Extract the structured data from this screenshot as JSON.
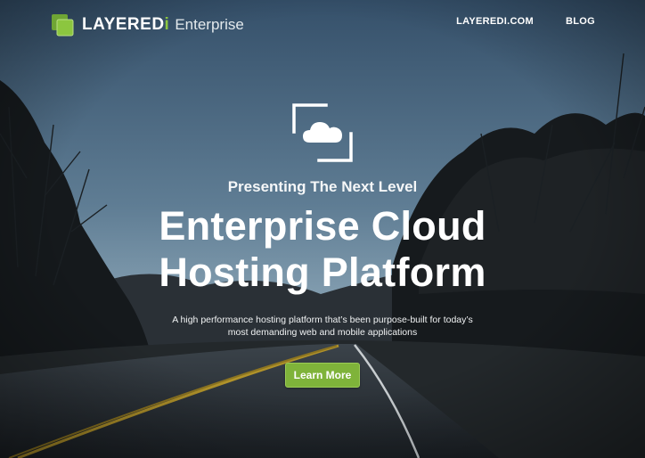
{
  "header": {
    "brand_name": "LAYERED",
    "brand_i": "i",
    "brand_sub": "Enterprise",
    "nav": [
      {
        "label": "LAYEREDI.COM"
      },
      {
        "label": "BLOG"
      }
    ]
  },
  "hero": {
    "icon": "cloud-icon",
    "eyebrow": "Presenting The Next Level",
    "headline_line1": "Enterprise Cloud",
    "headline_line2": "Hosting Platform",
    "tagline_line1": "A high performance hosting platform that’s been purpose-built for today’s",
    "tagline_line2": "most demanding web and mobile applications",
    "cta_label": "Learn More"
  },
  "colors": {
    "accent": "#8cc63f",
    "button": "#7fb33a",
    "sky_top": "#3d5a74",
    "sky_horizon": "#8aa6b8"
  }
}
